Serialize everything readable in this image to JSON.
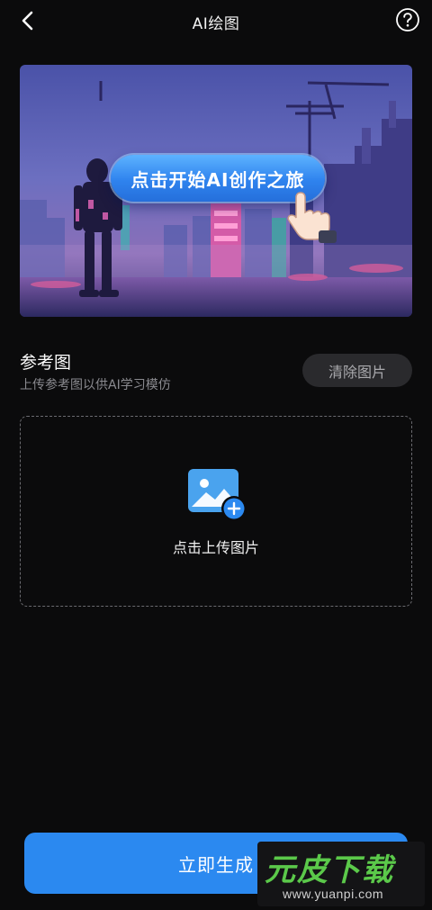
{
  "header": {
    "title": "AI绘图",
    "back_icon": "chevron-left-icon",
    "help_icon": "question-circle-icon"
  },
  "banner": {
    "cta_label": "点击开始AI创作之旅",
    "illustration": "cyberpunk-robot-city-illustration",
    "hand_icon": "pointing-hand-icon"
  },
  "reference": {
    "title": "参考图",
    "subtitle": "上传参考图以供AI学习模仿",
    "clear_label": "清除图片"
  },
  "upload": {
    "label": "点击上传图片",
    "icon": "add-image-icon"
  },
  "generate": {
    "label": "立即生成"
  },
  "watermark": {
    "mark": "元皮下载",
    "url": "www.yuanpi.com"
  },
  "colors": {
    "background": "#0b0b0c",
    "accent": "#2b89f0",
    "secondary_button": "#2a2a2d",
    "muted_text": "#8a8a8f",
    "watermark_green": "#5bc94a"
  }
}
